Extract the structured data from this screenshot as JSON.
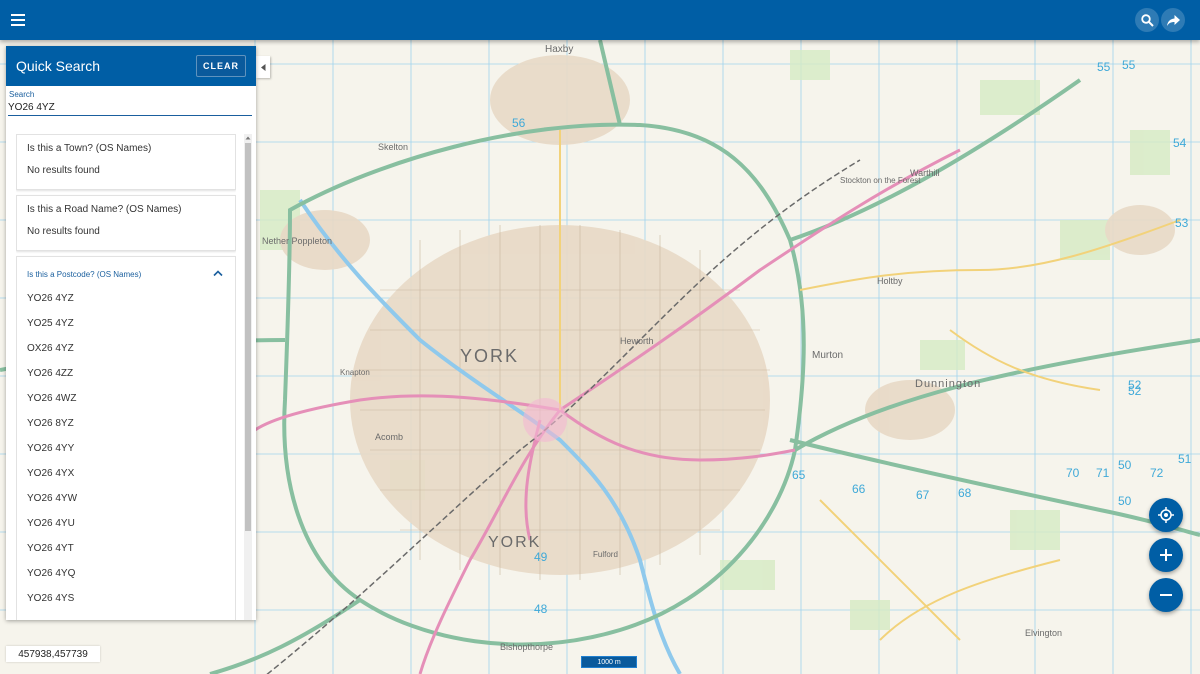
{
  "toolbar": {
    "menu_icon": "hamburger-menu-icon",
    "search_icon": "search-icon",
    "share_icon": "share-arrow-icon",
    "brand_color": "#005ea5"
  },
  "panel": {
    "title": "Quick Search",
    "clear_label": "CLEAR",
    "search_label": "Search",
    "search_value": "YO26 4YZ",
    "town_card": {
      "title": "Is this a Town? (OS Names)",
      "message": "No results found"
    },
    "road_card": {
      "title": "Is this a Road Name? (OS Names)",
      "message": "No results found"
    },
    "postcode_card": {
      "title": "Is this a Postcode? (OS Names)",
      "results": [
        "YO26 4YZ",
        "YO25 4YZ",
        "OX26 4YZ",
        "YO26 4ZZ",
        "YO26 4WZ",
        "YO26 8YZ",
        "YO26 4YY",
        "YO26 4YX",
        "YO26 4YW",
        "YO26 4YU",
        "YO26 4YT",
        "YO26 4YQ",
        "YO26 4YS"
      ]
    }
  },
  "map": {
    "coordinates": "457938,457739",
    "scale_label": "1000 m",
    "labels": {
      "york": "YORK",
      "york2": "YORK",
      "dunnington": "Dunnington",
      "murton": "Murton",
      "haxby": "Haxby",
      "nether_poppleton": "Nether Poppleton",
      "skelton": "Skelton",
      "warthill": "Warthill",
      "bishopthorpe": "Bishopthorpe",
      "elvington": "Elvington",
      "stockton": "Stockton on the Forest",
      "holtby": "Holtby",
      "heworth": "Heworth",
      "acomb": "Acomb",
      "knapton": "Knapton",
      "fulford": "Fulford"
    },
    "grid_numbers": [
      "56",
      "55",
      "54",
      "53",
      "52",
      "51",
      "50",
      "49",
      "48",
      "65",
      "66",
      "67",
      "68",
      "70",
      "71",
      "72",
      "55",
      "52",
      "50"
    ]
  },
  "fabs": {
    "locate_icon": "crosshair-locate-icon",
    "zoom_in_icon": "plus-icon",
    "zoom_out_icon": "minus-icon"
  }
}
